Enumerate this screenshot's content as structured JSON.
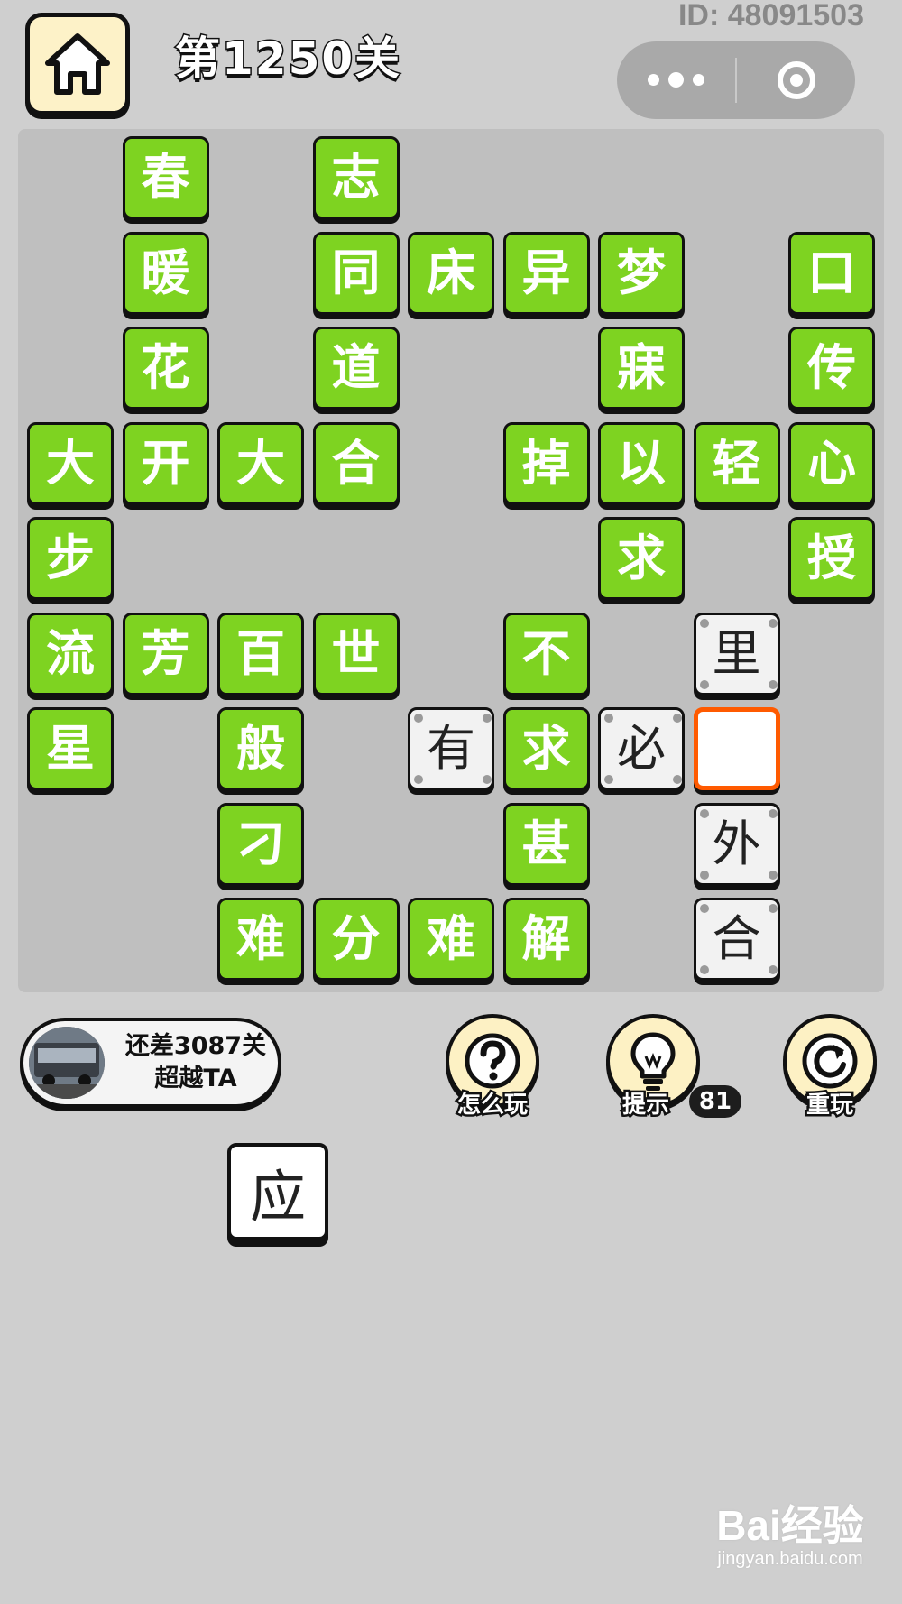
{
  "header": {
    "level_title": "第1250关",
    "user_id": "ID: 48091503",
    "home_icon": "home-icon",
    "menu_icon": "more-dots-icon",
    "close_icon": "target-circle-icon"
  },
  "board": {
    "cells": [
      {
        "row": 0,
        "col": 1,
        "char": "春",
        "state": "fixed"
      },
      {
        "row": 0,
        "col": 3,
        "char": "志",
        "state": "fixed"
      },
      {
        "row": 1,
        "col": 1,
        "char": "暖",
        "state": "fixed"
      },
      {
        "row": 1,
        "col": 3,
        "char": "同",
        "state": "fixed"
      },
      {
        "row": 1,
        "col": 4,
        "char": "床",
        "state": "fixed"
      },
      {
        "row": 1,
        "col": 5,
        "char": "异",
        "state": "fixed"
      },
      {
        "row": 1,
        "col": 6,
        "char": "梦",
        "state": "fixed"
      },
      {
        "row": 1,
        "col": 8,
        "char": "口",
        "state": "fixed"
      },
      {
        "row": 2,
        "col": 1,
        "char": "花",
        "state": "fixed"
      },
      {
        "row": 2,
        "col": 3,
        "char": "道",
        "state": "fixed"
      },
      {
        "row": 2,
        "col": 6,
        "char": "寐",
        "state": "fixed"
      },
      {
        "row": 2,
        "col": 8,
        "char": "传",
        "state": "fixed"
      },
      {
        "row": 3,
        "col": 0,
        "char": "大",
        "state": "fixed"
      },
      {
        "row": 3,
        "col": 1,
        "char": "开",
        "state": "fixed"
      },
      {
        "row": 3,
        "col": 2,
        "char": "大",
        "state": "fixed"
      },
      {
        "row": 3,
        "col": 3,
        "char": "合",
        "state": "fixed"
      },
      {
        "row": 3,
        "col": 5,
        "char": "掉",
        "state": "fixed"
      },
      {
        "row": 3,
        "col": 6,
        "char": "以",
        "state": "fixed"
      },
      {
        "row": 3,
        "col": 7,
        "char": "轻",
        "state": "fixed"
      },
      {
        "row": 3,
        "col": 8,
        "char": "心",
        "state": "fixed"
      },
      {
        "row": 4,
        "col": 0,
        "char": "步",
        "state": "fixed"
      },
      {
        "row": 4,
        "col": 6,
        "char": "求",
        "state": "fixed"
      },
      {
        "row": 4,
        "col": 8,
        "char": "授",
        "state": "fixed"
      },
      {
        "row": 5,
        "col": 0,
        "char": "流",
        "state": "fixed"
      },
      {
        "row": 5,
        "col": 1,
        "char": "芳",
        "state": "fixed"
      },
      {
        "row": 5,
        "col": 2,
        "char": "百",
        "state": "fixed"
      },
      {
        "row": 5,
        "col": 3,
        "char": "世",
        "state": "fixed"
      },
      {
        "row": 5,
        "col": 5,
        "char": "不",
        "state": "fixed"
      },
      {
        "row": 5,
        "col": 7,
        "char": "里",
        "state": "filled"
      },
      {
        "row": 6,
        "col": 0,
        "char": "星",
        "state": "fixed"
      },
      {
        "row": 6,
        "col": 2,
        "char": "般",
        "state": "fixed"
      },
      {
        "row": 6,
        "col": 4,
        "char": "有",
        "state": "filled"
      },
      {
        "row": 6,
        "col": 5,
        "char": "求",
        "state": "fixed"
      },
      {
        "row": 6,
        "col": 6,
        "char": "必",
        "state": "filled"
      },
      {
        "row": 6,
        "col": 7,
        "char": "",
        "state": "selected"
      },
      {
        "row": 7,
        "col": 2,
        "char": "刁",
        "state": "fixed"
      },
      {
        "row": 7,
        "col": 5,
        "char": "甚",
        "state": "fixed"
      },
      {
        "row": 7,
        "col": 7,
        "char": "外",
        "state": "filled"
      },
      {
        "row": 8,
        "col": 2,
        "char": "难",
        "state": "fixed"
      },
      {
        "row": 8,
        "col": 3,
        "char": "分",
        "state": "fixed"
      },
      {
        "row": 8,
        "col": 4,
        "char": "难",
        "state": "fixed"
      },
      {
        "row": 8,
        "col": 5,
        "char": "解",
        "state": "fixed"
      },
      {
        "row": 8,
        "col": 7,
        "char": "合",
        "state": "filled"
      }
    ]
  },
  "rank": {
    "line1": "还差3087关",
    "line2": "超越TA"
  },
  "tools": {
    "how_to_play": {
      "label": "怎么玩",
      "icon": "question-icon"
    },
    "hint": {
      "label": "提示",
      "icon": "lightbulb-icon",
      "count": "81"
    },
    "replay": {
      "label": "重玩",
      "icon": "replay-icon"
    }
  },
  "options": [
    {
      "char": "应"
    }
  ],
  "watermark": {
    "brand": "Bai经验",
    "url": "jingyan.baidu.com"
  },
  "colors": {
    "fixed_tile": "#7ed321",
    "selected_border": "#ff5a00",
    "background": "#cfcfcf",
    "button_cream": "#fdf1c4"
  }
}
